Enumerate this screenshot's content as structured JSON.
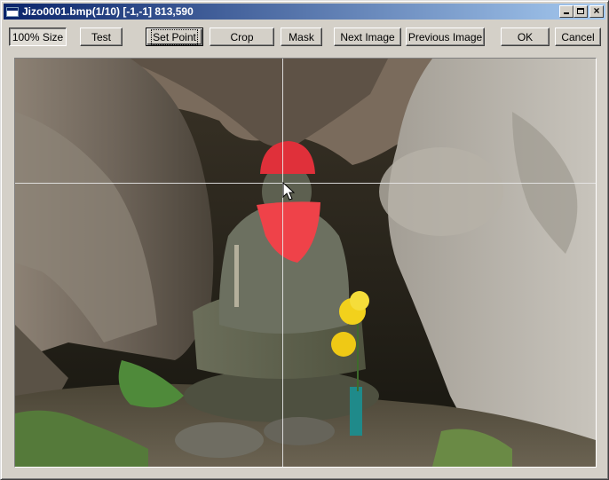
{
  "window": {
    "title": "Jizo0001.bmp(1/10) [-1,-1] 813,590"
  },
  "caption_buttons": {
    "minimize": "minimize",
    "maximize": "maximize",
    "close": "×"
  },
  "toolbar": {
    "size_label": "100% Size",
    "test_label": "Test",
    "set_point_label": "Set Point",
    "crop_label": "Crop",
    "mask_label": "Mask",
    "next_label": "Next Image",
    "previous_label": "Previous Image",
    "ok_label": "OK",
    "cancel_label": "Cancel"
  },
  "image": {
    "subject": "jizo statue photo",
    "accent_colors": {
      "hat": "#e0303a",
      "bib": "#ef4249",
      "flowers": "#f2d11c",
      "crosshair": "#e8e8e8"
    }
  }
}
